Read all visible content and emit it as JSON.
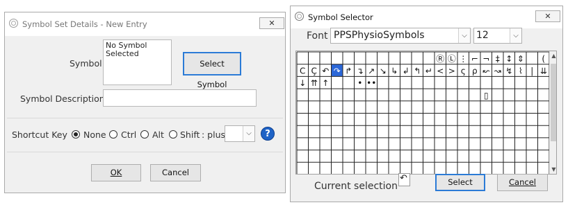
{
  "details": {
    "title": "Symbol Set Details - New Entry",
    "close_glyph": "✕",
    "symbol_label": "Symbol",
    "symbol_preview": "No Symbol Selected",
    "select_symbol_button": "Select Symbol",
    "description_label": "Symbol Description",
    "description_value": "",
    "shortcut_label": "Shortcut Key",
    "shortcut_options": [
      "None",
      "Ctrl",
      "Alt",
      "Shift"
    ],
    "shortcut_selected": "None",
    "plus_label": ": plus",
    "plus_value": "",
    "help_glyph": "?",
    "ok_button": "OK",
    "cancel_button": "Cancel"
  },
  "selector": {
    "title": "Symbol Selector",
    "close_glyph": "✕",
    "font_label": "Font",
    "font_value": "PPSPhysioSymbols",
    "size_value": "12",
    "current_selection_label": "Current selection",
    "current_selection_glyph": "↶",
    "select_button": "Select",
    "cancel_button": "Cancel",
    "grid": {
      "columns": 22,
      "rows": 10,
      "selected_cell": [
        1,
        3
      ],
      "glyphs": [
        {
          "row": 0,
          "col": 12,
          "glyph": "Ⓡ"
        },
        {
          "row": 0,
          "col": 13,
          "glyph": "Ⓛ"
        },
        {
          "row": 0,
          "col": 14,
          "glyph": "⋮"
        },
        {
          "row": 0,
          "col": 15,
          "glyph": "⌐"
        },
        {
          "row": 0,
          "col": 16,
          "glyph": "¬"
        },
        {
          "row": 0,
          "col": 17,
          "glyph": "‡"
        },
        {
          "row": 0,
          "col": 18,
          "glyph": "↕"
        },
        {
          "row": 0,
          "col": 19,
          "glyph": "⇕"
        },
        {
          "row": 0,
          "col": 21,
          "glyph": "("
        },
        {
          "row": 1,
          "col": 0,
          "glyph": "C"
        },
        {
          "row": 1,
          "col": 1,
          "glyph": "Ç"
        },
        {
          "row": 1,
          "col": 2,
          "glyph": "↶"
        },
        {
          "row": 1,
          "col": 3,
          "glyph": "↷"
        },
        {
          "row": 1,
          "col": 4,
          "glyph": "↱"
        },
        {
          "row": 1,
          "col": 5,
          "glyph": "↴"
        },
        {
          "row": 1,
          "col": 6,
          "glyph": "↗"
        },
        {
          "row": 1,
          "col": 7,
          "glyph": "↘"
        },
        {
          "row": 1,
          "col": 8,
          "glyph": "↳"
        },
        {
          "row": 1,
          "col": 9,
          "glyph": "↲"
        },
        {
          "row": 1,
          "col": 10,
          "glyph": "↰"
        },
        {
          "row": 1,
          "col": 11,
          "glyph": "↵"
        },
        {
          "row": 1,
          "col": 12,
          "glyph": "<"
        },
        {
          "row": 1,
          "col": 13,
          "glyph": ">"
        },
        {
          "row": 1,
          "col": 14,
          "glyph": "ς"
        },
        {
          "row": 1,
          "col": 15,
          "glyph": "ρ"
        },
        {
          "row": 1,
          "col": 16,
          "glyph": "↜"
        },
        {
          "row": 1,
          "col": 17,
          "glyph": "↝"
        },
        {
          "row": 1,
          "col": 18,
          "glyph": "↯"
        },
        {
          "row": 1,
          "col": 19,
          "glyph": "⌇"
        },
        {
          "row": 1,
          "col": 20,
          "glyph": "|"
        },
        {
          "row": 1,
          "col": 21,
          "glyph": "⇊"
        },
        {
          "row": 2,
          "col": 0,
          "glyph": "↓"
        },
        {
          "row": 2,
          "col": 1,
          "glyph": "⇈"
        },
        {
          "row": 2,
          "col": 2,
          "glyph": "↑"
        },
        {
          "row": 2,
          "col": 5,
          "glyph": "•"
        },
        {
          "row": 2,
          "col": 6,
          "glyph": "••"
        },
        {
          "row": 3,
          "col": 16,
          "glyph": "▯"
        }
      ]
    }
  }
}
